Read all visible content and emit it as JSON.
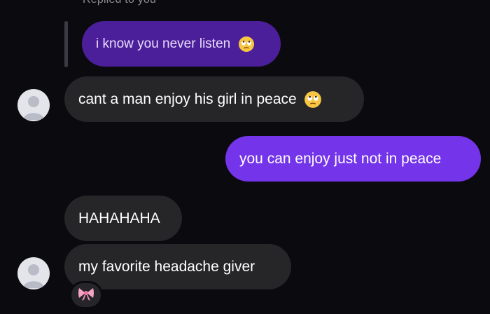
{
  "reply_context": {
    "label": "Replied to you",
    "quoted_message": "i know you never listen",
    "quoted_emoji": "face-with-rolling-eyes-icon"
  },
  "messages": [
    {
      "direction": "incoming",
      "text": "cant a man enjoy his girl in peace",
      "emoji": "face-with-rolling-eyes-icon"
    },
    {
      "direction": "outgoing",
      "text": "you can enjoy just not in peace"
    },
    {
      "direction": "incoming",
      "text": "HAHAHAHA"
    },
    {
      "direction": "incoming",
      "text": "my favorite headache giver",
      "reaction": "pink-bow-icon"
    }
  ],
  "colors": {
    "background": "#0b0b0f",
    "incoming_bubble": "#262629",
    "outgoing_bubble": "#7434ea",
    "replied_bubble": "#4c1f9a",
    "meta_text": "#8b8b95"
  }
}
